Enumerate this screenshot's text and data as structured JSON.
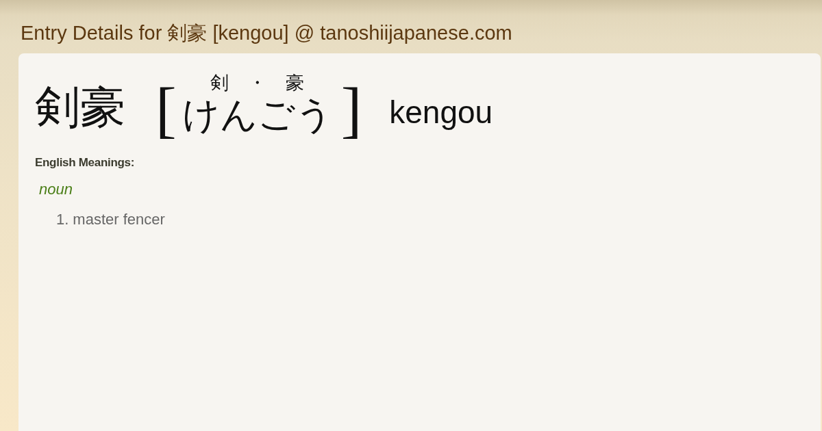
{
  "page": {
    "title": "Entry Details for 剣豪 [kengou] @ tanoshiijapanese.com"
  },
  "entry": {
    "headword": "剣豪",
    "brackets": [
      "[",
      "]"
    ],
    "kanji_guide": [
      "剣",
      "・",
      "豪"
    ],
    "reading": "けんごう",
    "romaji": "kengou"
  },
  "meanings": {
    "heading": "English Meanings:",
    "groups": [
      {
        "part_of_speech": "noun",
        "senses": [
          {
            "number": "1.",
            "text": "master fencer"
          }
        ]
      }
    ]
  }
}
